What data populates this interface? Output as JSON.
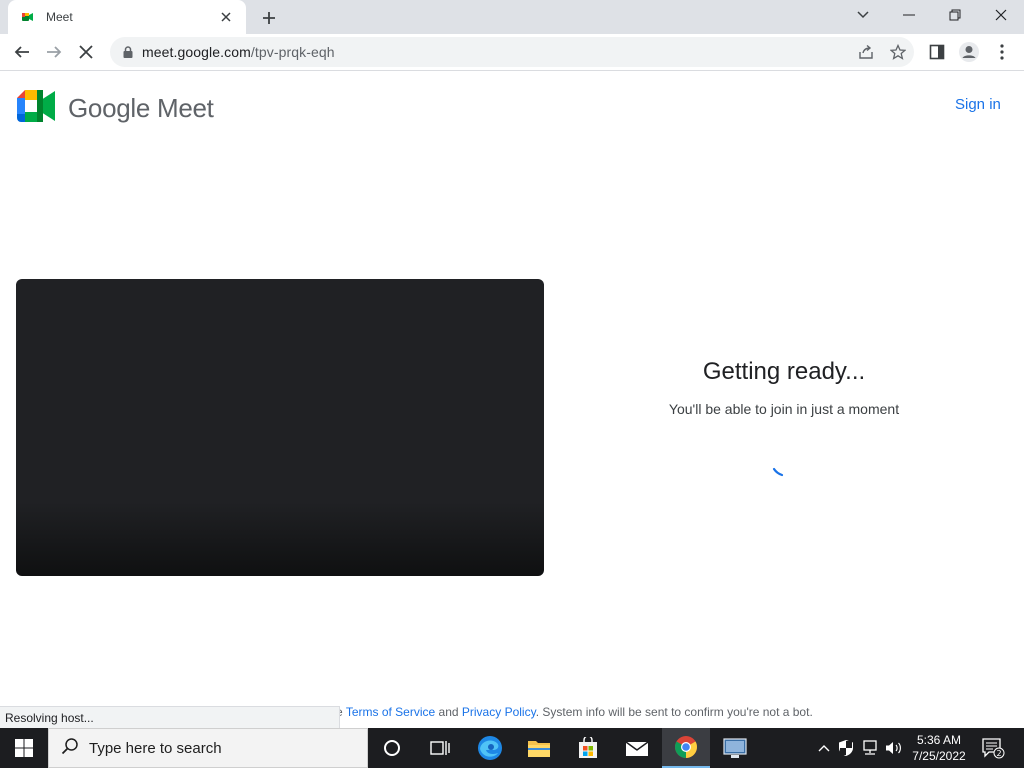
{
  "browser": {
    "tab_title": "Meet",
    "url_host": "meet.google.com",
    "url_path": "/tpv-prqk-eqh",
    "status_text": "Resolving host..."
  },
  "meet": {
    "brand_google": "Google",
    "brand_meet": "Meet",
    "sign_in": "Sign in",
    "ready_title": "Getting ready...",
    "ready_subtitle": "You'll be able to join in just a moment",
    "footer_prefix": "e",
    "terms_link": "Terms of Service",
    "footer_and": "and",
    "privacy_link": "Privacy Policy",
    "footer_suffix": ". System info will be sent to confirm you're not a bot."
  },
  "taskbar": {
    "search_placeholder": "Type here to search",
    "time": "5:36 AM",
    "date": "7/25/2022",
    "notification_count": "2"
  },
  "colors": {
    "accent_blue": "#1a73e8",
    "preview_bg": "#202124",
    "taskbar_bg": "#1c1d20"
  }
}
